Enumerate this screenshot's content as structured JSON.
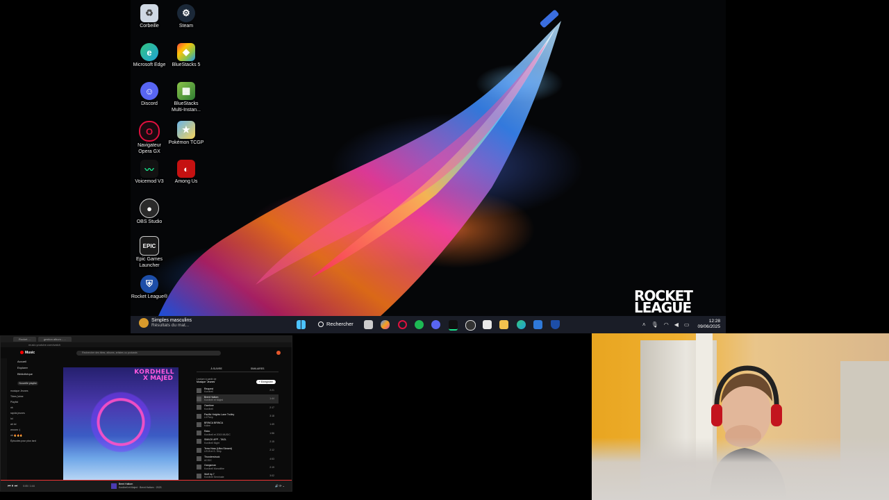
{
  "desktop": {
    "icons": [
      {
        "label": "Corbeille",
        "icon": "recycle-bin-icon",
        "color": "#cfd8e3"
      },
      {
        "label": "Steam",
        "icon": "steam-icon",
        "color": "#1b2838"
      },
      {
        "label": "Microsoft Edge",
        "icon": "edge-icon",
        "color": "#1fa2d6"
      },
      {
        "label": "BlueStacks 5",
        "icon": "bluestacks-icon",
        "color": "#8bc34a"
      },
      {
        "label": "Discord",
        "icon": "discord-icon",
        "color": "#5865f2"
      },
      {
        "label": "BlueStacks Multi-Instan...",
        "icon": "bluestacks-multi-icon",
        "color": "#4caf50"
      },
      {
        "label": "Navigateur Opera GX",
        "icon": "opera-gx-icon",
        "color": "#e0103e"
      },
      {
        "label": "Pokémon TCGP",
        "icon": "pokemon-tcgp-icon",
        "color": "#6ab4e8"
      },
      {
        "label": "Voicemod V3",
        "icon": "voicemod-icon",
        "color": "#121212"
      },
      {
        "label": "Among Us",
        "icon": "among-us-icon",
        "color": "#c51111"
      },
      {
        "label": "OBS Studio",
        "icon": "obs-icon",
        "color": "#2a2a2a"
      },
      {
        "label": "Epic Games Launcher",
        "icon": "epic-games-icon",
        "color": "#1a1a1a"
      },
      {
        "label": "Rocket League®",
        "icon": "rocket-league-icon",
        "color": "#1d4ea8"
      }
    ],
    "wallpaper_logo_line1": "ROCKET",
    "wallpaper_logo_line2": "LEAGUE"
  },
  "taskbar": {
    "widget_title": "Simples masculins",
    "widget_subtitle": "Résultats du mat...",
    "search_label": "Rechercher",
    "apps": [
      "windows-start-icon",
      "task-view-icon",
      "copilot-icon",
      "opera-gx-icon",
      "spotify-icon",
      "discord-icon",
      "voicemod-icon",
      "obs-icon",
      "calendar-icon",
      "file-explorer-icon",
      "edge-icon",
      "azure-icon",
      "defender-icon"
    ],
    "time": "12:28",
    "date": "09/06/2025"
  },
  "music": {
    "tab_1": "Rocket ...",
    "tab_2": "gestion album - ...",
    "url": "music.youtube.com/watch",
    "logo": "Music",
    "search_placeholder": "Rechercher des titres, albums, artistes ou podcasts",
    "nav": [
      "Accueil",
      "Explorer",
      "Bibliothèque"
    ],
    "new_playlist": "Nouvelle playlist",
    "side_items": [
      "musique Jeunes",
      "Titres j'aime",
      "Playlist",
      "ok",
      "rapids jeunes",
      "lol",
      "ah lol",
      "wooow :)",
      "ok 🔥🔥🔥",
      "Épisodes pour plus tard"
    ],
    "cover_line1": "KORDHELL",
    "cover_line2": "X MAJED",
    "queue_tab_1": "À SUIVRE",
    "queue_tab_2": "SIMILAIRES",
    "queue_info_1": "Lecture à partir de",
    "queue_info_2": "Musique 'Jeunes'",
    "save_label": "+ Enregistrer",
    "tracks": [
      {
        "title": "Request",
        "artist": "Kordhell",
        "duration": "2:21"
      },
      {
        "title": "Brent Haltom",
        "artist": "Kordhell et Majed",
        "duration": "1:44"
      },
      {
        "title": "Owntime",
        "artist": "Kordhell",
        "duration": "2:17"
      },
      {
        "title": "Pacific Heights Lane Trolley",
        "artist": "Lil Peep",
        "duration": "3:18"
      },
      {
        "title": "BRINCA BRINCA",
        "artist": "Kdlee",
        "duration": "1:49"
      },
      {
        "title": "Rabo",
        "artist": "Kordhell et 2015 MUSIC",
        "duration": "1:56"
      },
      {
        "title": "SMACK APP - TAGL",
        "artist": "Kordhell Night",
        "duration": "2:15"
      },
      {
        "title": "Terra Hoss (Ultra Slowed)",
        "artist": "LEV8 et S. Ship",
        "duration": "2:12"
      },
      {
        "title": "Thunderstruck",
        "artist": "AC/DC",
        "duration": "4:53"
      },
      {
        "title": "Gangsman",
        "artist": "Kordhell Monolithe",
        "duration": "2:19"
      },
      {
        "title": "Wolf rip 7",
        "artist": "Kordhell Seminate",
        "duration": "3:02"
      }
    ],
    "player_time": "0:05 / 1:44",
    "now_title": "Brent Haltom",
    "now_artist": "Kordhell et Majed · Brent Haltom · 2023",
    "progress": 0.05
  }
}
